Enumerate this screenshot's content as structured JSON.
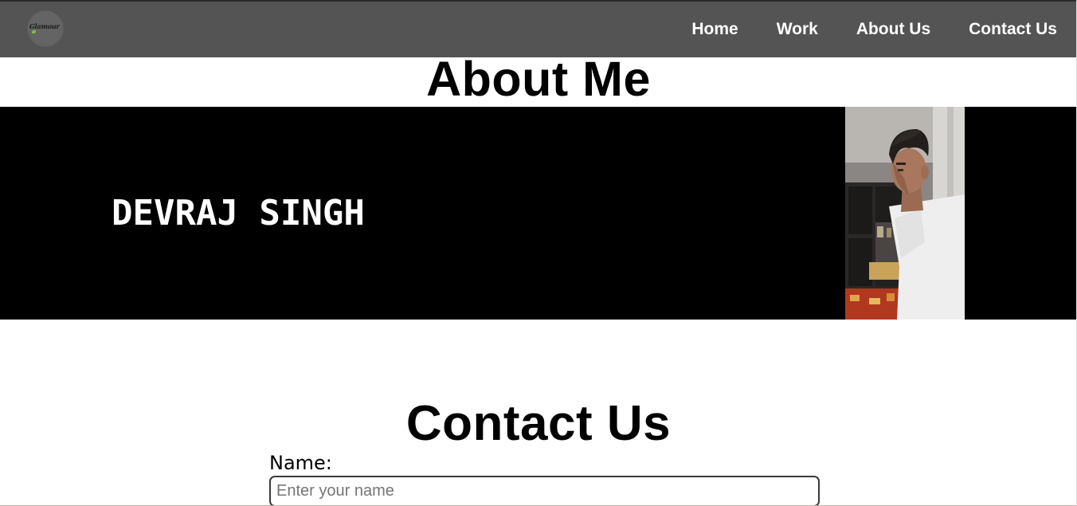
{
  "navbar": {
    "logo_text": "Glamour",
    "links": [
      {
        "label": "Home"
      },
      {
        "label": "Work"
      },
      {
        "label": "About Us"
      },
      {
        "label": "Contact Us"
      }
    ]
  },
  "about": {
    "title": "About Me",
    "name": "DEVRAJ SINGH",
    "photo": "portrait-photo"
  },
  "contact": {
    "title": "Contact Us",
    "name_label": "Name:",
    "name_value": "",
    "name_placeholder": "Enter your name"
  },
  "colors": {
    "navbar_bg": "#545454",
    "band_bg": "#000000",
    "text_light": "#ffffff",
    "text_dark": "#000000"
  }
}
